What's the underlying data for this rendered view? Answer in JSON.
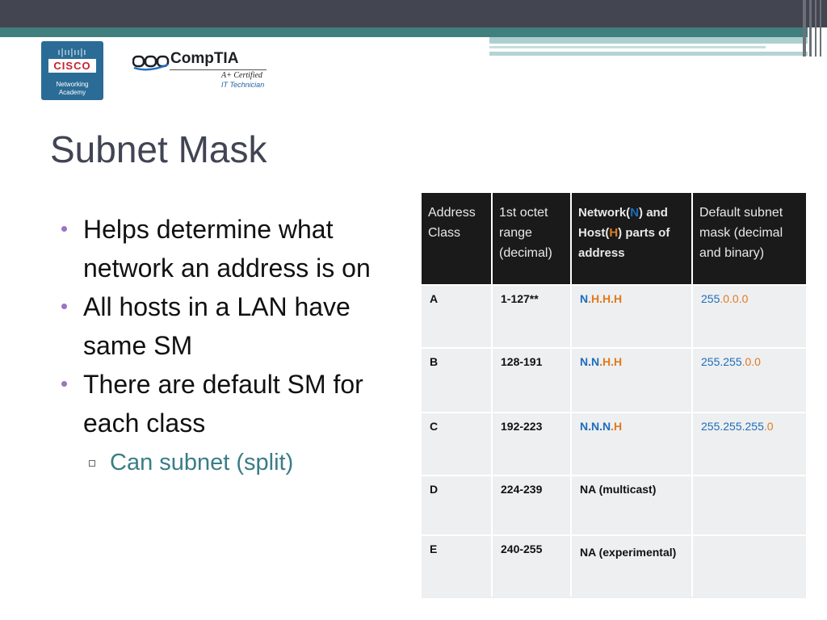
{
  "logos": {
    "cisco": {
      "bars": "ı|ıı|ıı|ı",
      "name": "CISCO",
      "line1": "Networking",
      "line2": "Academy"
    },
    "comptia": {
      "name": "CompTIA",
      "cert": "A+ Certified",
      "tech": "IT Technician"
    }
  },
  "slide": {
    "title": "Subnet Mask",
    "bullets": [
      "Helps determine what network an address is on",
      "All hosts in a LAN have same SM",
      "There are default SM for each class"
    ],
    "sub_bullet": "Can subnet (split)"
  },
  "table": {
    "headers": {
      "class": "Address Class",
      "range": "1st octet range (decimal)",
      "parts_pre": "Network(",
      "parts_n": "N",
      "parts_mid": ") and Host(",
      "parts_h": "H",
      "parts_post": ") parts of address",
      "mask": "Default subnet mask (decimal and binary)"
    },
    "rows": [
      {
        "class": "A",
        "range": "1-127**",
        "parts_n": "N",
        "parts_h": ".H.H.H",
        "mask_n": "255",
        "mask_h": ".0.0.0"
      },
      {
        "class": "B",
        "range": "128-191",
        "parts_n": "N.N",
        "parts_h": ".H.H",
        "mask_n": "255.255",
        "mask_h": ".0.0"
      },
      {
        "class": "C",
        "range": "192-223",
        "parts_n": "N.N.N",
        "parts_h": ".H",
        "mask_n": "255.255.255",
        "mask_h": ".0"
      },
      {
        "class": "D",
        "range": "224-239",
        "parts_text": "NA (multicast)"
      },
      {
        "class": "E",
        "range": "240-255",
        "parts_text": "NA (experimental)"
      }
    ]
  },
  "colors": {
    "network": "#1d6dbb",
    "host": "#e07a22",
    "bullet": "#9b74c2",
    "sub_text": "#3a7d86"
  }
}
